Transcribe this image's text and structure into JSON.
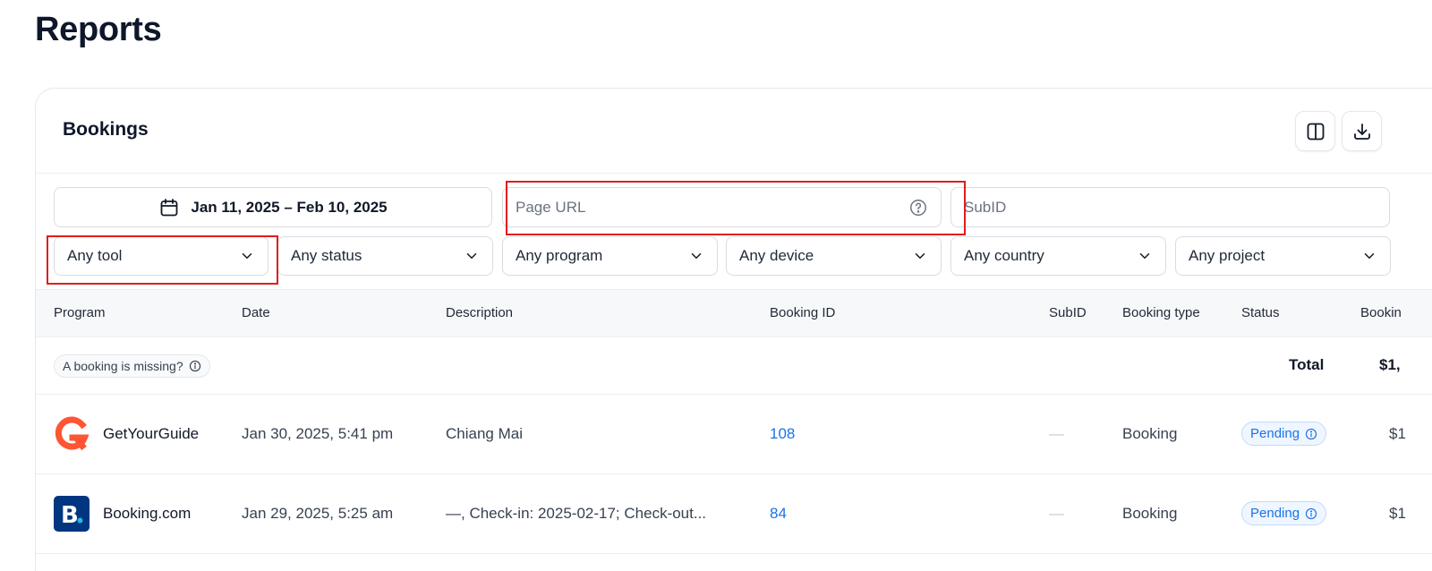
{
  "page": {
    "title": "Reports"
  },
  "card": {
    "title": "Bookings",
    "toolbar": {
      "columns_icon": "columns-icon",
      "download_icon": "download-icon"
    }
  },
  "filters": {
    "date_range": "Jan 11, 2025 – Feb 10, 2025",
    "page_url_placeholder": "Page URL",
    "subid_placeholder": "SubID",
    "selects": [
      {
        "label": "Any tool"
      },
      {
        "label": "Any status"
      },
      {
        "label": "Any program"
      },
      {
        "label": "Any device"
      },
      {
        "label": "Any country"
      },
      {
        "label": "Any project"
      }
    ]
  },
  "table": {
    "columns": [
      "Program",
      "Date",
      "Description",
      "Booking ID",
      "SubID",
      "Booking type",
      "Status",
      "Bookin"
    ],
    "missing_label": "A booking is missing?",
    "total_label": "Total",
    "total_value": "$1,",
    "rows": [
      {
        "program": "GetYourGuide",
        "logo": "getyourguide-logo",
        "date": "Jan 30, 2025, 5:41 pm",
        "description": "Chiang Mai",
        "booking_id": "108",
        "subid": "—",
        "booking_type": "Booking",
        "status": "Pending",
        "amount": "$1"
      },
      {
        "program": "Booking.com",
        "logo": "booking-com-logo",
        "date": "Jan 29, 2025, 5:25 am",
        "description": "—, Check-in: 2025-02-17; Check-out...",
        "booking_id": "84",
        "subid": "—",
        "booking_type": "Booking",
        "status": "Pending",
        "amount": "$1"
      }
    ]
  },
  "colors": {
    "accent": "#1a73e8",
    "highlight": "#e11d1d",
    "getyourguide": "#ff5533",
    "booking": "#003580"
  }
}
